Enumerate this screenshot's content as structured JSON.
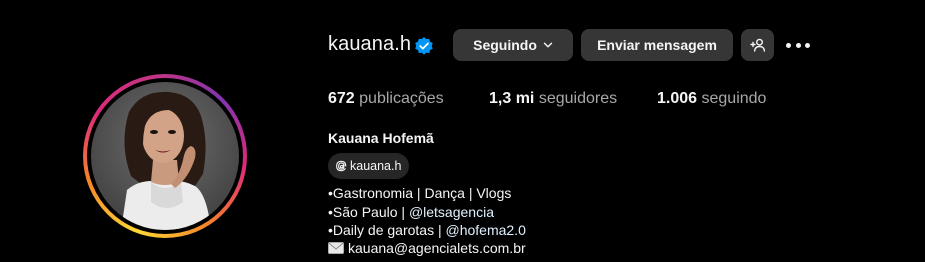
{
  "profile": {
    "username": "kauana.h",
    "verified_icon": "verified-badge-icon",
    "full_name": "Kauana Hofemã",
    "threads_handle": "kauana.h"
  },
  "actions": {
    "following_label": "Seguindo",
    "message_label": "Enviar mensagem",
    "suggest_icon": "person-add-icon",
    "more_icon": "more-options-icon"
  },
  "stats": {
    "posts_count": "672",
    "posts_label": "publicações",
    "followers_count": "1,3 mi",
    "followers_label": "seguidores",
    "following_count": "1.006",
    "following_label": "seguindo"
  },
  "bio": {
    "line1": "•Gastronomia | Dança | Vlogs",
    "line2_prefix": "•São Paulo | ",
    "line2_mention": "@letsagencia",
    "line3_prefix": "•Daily de garotas | ",
    "line3_mention": "@hofema2.0",
    "line4": "kauana@agencialets.com.br"
  },
  "colors": {
    "background": "#000000",
    "button": "#363636",
    "verified": "#0095f6",
    "secondary_text": "#a8a8a8",
    "mention": "#e0f1ff"
  }
}
